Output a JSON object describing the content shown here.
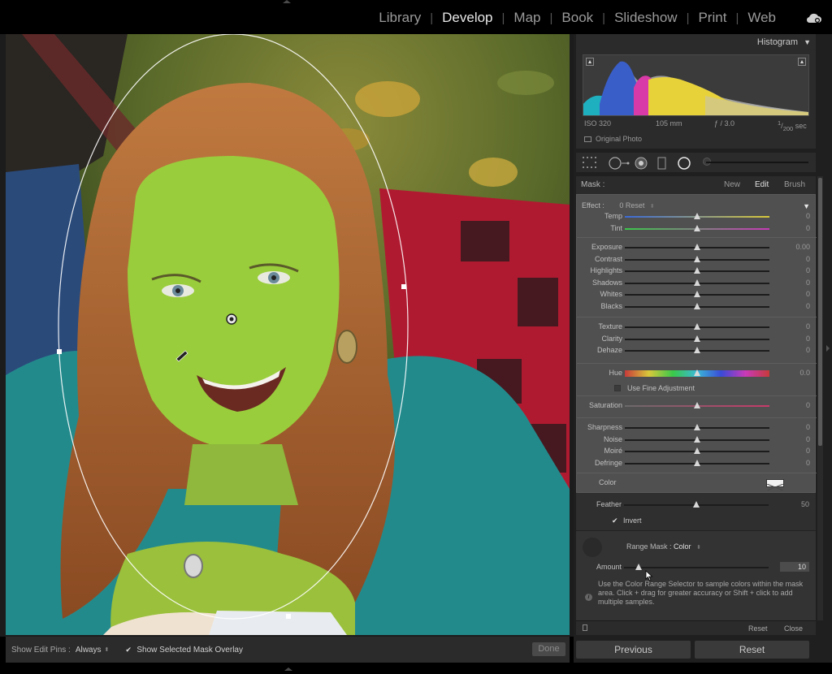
{
  "modules": [
    "Library",
    "Develop",
    "Map",
    "Book",
    "Slideshow",
    "Print",
    "Web"
  ],
  "active_module": "Develop",
  "histogram": {
    "title": "Histogram",
    "iso": "ISO 320",
    "focal": "105 mm",
    "aperture": "ƒ / 3.0",
    "shutter_num": "1",
    "shutter_den": "200",
    "shutter_unit": "sec",
    "original_photo": "Original Photo"
  },
  "mask": {
    "label": "Mask :",
    "new": "New",
    "edit": "Edit",
    "brush": "Brush",
    "active": "Edit"
  },
  "effect": {
    "label": "Effect :",
    "value": "0 Reset",
    "groups": [
      [
        {
          "name": "Temp",
          "value": "0",
          "pos": 0.5,
          "track": "temp"
        },
        {
          "name": "Tint",
          "value": "0",
          "pos": 0.5,
          "track": "tint"
        }
      ],
      [
        {
          "name": "Exposure",
          "value": "0.00",
          "pos": 0.5
        },
        {
          "name": "Contrast",
          "value": "0",
          "pos": 0.5
        },
        {
          "name": "Highlights",
          "value": "0",
          "pos": 0.5
        },
        {
          "name": "Shadows",
          "value": "0",
          "pos": 0.5
        },
        {
          "name": "Whites",
          "value": "0",
          "pos": 0.5
        },
        {
          "name": "Blacks",
          "value": "0",
          "pos": 0.5
        }
      ],
      [
        {
          "name": "Texture",
          "value": "0",
          "pos": 0.5
        },
        {
          "name": "Clarity",
          "value": "0",
          "pos": 0.5
        },
        {
          "name": "Dehaze",
          "value": "0",
          "pos": 0.5
        }
      ],
      [
        {
          "name": "Hue",
          "value": "0.0",
          "pos": 0.5,
          "track": "hue"
        }
      ],
      [
        {
          "name": "Saturation",
          "value": "0",
          "pos": 0.5,
          "track": "sat"
        }
      ],
      [
        {
          "name": "Sharpness",
          "value": "0",
          "pos": 0.5
        },
        {
          "name": "Noise",
          "value": "0",
          "pos": 0.5
        },
        {
          "name": "Moiré",
          "value": "0",
          "pos": 0.5
        },
        {
          "name": "Defringe",
          "value": "0",
          "pos": 0.5
        }
      ]
    ],
    "fine_adjustment": "Use Fine Adjustment",
    "color_label": "Color"
  },
  "feather": {
    "name": "Feather",
    "value": "50",
    "pos": 0.5
  },
  "invert": {
    "label": "Invert",
    "checked": true
  },
  "range_mask": {
    "label": "Range Mask :",
    "type": "Color",
    "amount": {
      "name": "Amount",
      "value": "10",
      "pos": 0.1
    },
    "info": "Use the Color Range Selector to sample colors within the mask area. Click + drag for greater accuracy or Shift + click to add multiple samples."
  },
  "panel_actions": {
    "reset": "Reset",
    "close": "Close"
  },
  "nav": {
    "previous": "Previous",
    "reset": "Reset"
  },
  "toolbar": {
    "edit_pins_label": "Show Edit Pins :",
    "edit_pins_value": "Always",
    "mask_overlay_label": "Show Selected Mask Overlay",
    "done": "Done"
  },
  "colors": {
    "mask_overlay": "#9ACD32",
    "shirt": "#2a8a8a",
    "hair": "#a0582a",
    "blanket_red": "#c0203a"
  }
}
